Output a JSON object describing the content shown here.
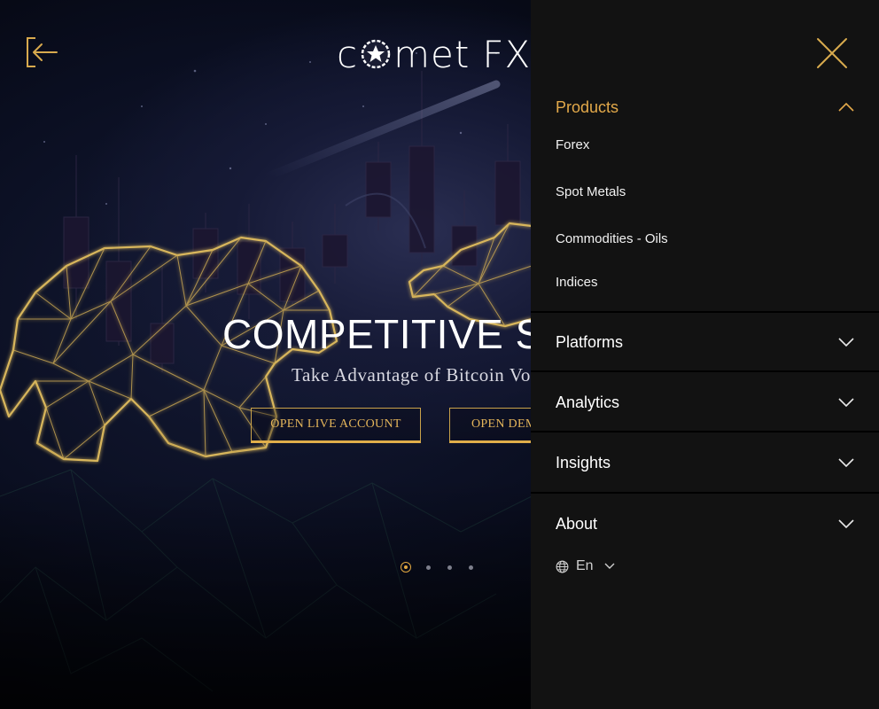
{
  "brand": {
    "logo_part_1": "c",
    "logo_part_2": "met",
    "logo_part_3": "FX"
  },
  "hero": {
    "headline": "COMPETITIVE SP",
    "subline": "Take Advantage of Bitcoin Vo",
    "cta_live": "OPEN LIVE ACCOUNT",
    "cta_demo": "OPEN DEM",
    "slides_total": 4,
    "active_slide": 1
  },
  "menu": {
    "sections": [
      {
        "label": "Products",
        "expanded": true,
        "items": [
          "Forex",
          "Spot Metals",
          "Commodities - Oils",
          "Indices"
        ]
      },
      {
        "label": "Platforms",
        "expanded": false
      },
      {
        "label": "Analytics",
        "expanded": false
      },
      {
        "label": "Insights",
        "expanded": false
      },
      {
        "label": "About",
        "expanded": false
      }
    ],
    "language": "En"
  },
  "colors": {
    "accent": "#e3a94a",
    "menu_bg": "#121212",
    "divider": "#000000",
    "hero_line": "#d8b65c"
  },
  "icons": {
    "back": "arrow-left-bracket-icon",
    "close": "close-x-icon",
    "expanded_chevron": "chevron-up-icon",
    "collapsed_chevron": "chevron-down-icon",
    "language": "globe-icon"
  }
}
